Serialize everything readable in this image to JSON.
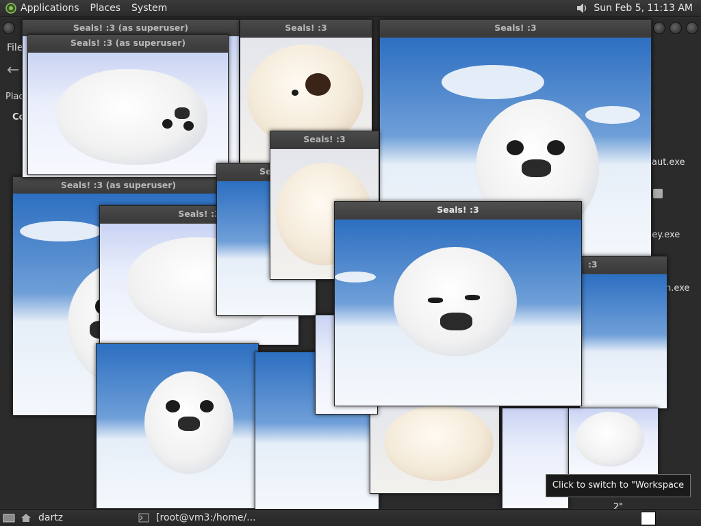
{
  "panel": {
    "menus": [
      "Applications",
      "Places",
      "System"
    ],
    "clock": "Sun Feb  5, 11:13 AM"
  },
  "background_window": {
    "fragments": [
      "File",
      "Plac",
      "Co",
      "aut.exe",
      "gey.exe",
      "h.exe"
    ]
  },
  "windows": [
    {
      "title": "Seals! :3 (as superuser)"
    },
    {
      "title": "Seals! :3"
    },
    {
      "title": "Seals! :3"
    },
    {
      "title": "Seals! :3 (as superuser)"
    },
    {
      "title": "Seals! :3 (as superuser)"
    },
    {
      "title": "Seals! :3"
    },
    {
      "title": "Se"
    },
    {
      "title": "Seals! :3"
    },
    {
      "title": "Seals! :3"
    },
    {
      "title": ":3"
    }
  ],
  "tooltip": "Click to switch to \"Workspace 2\"",
  "taskbar": {
    "items": [
      "dartz",
      "[root@vm3:/home/..."
    ]
  },
  "icons": [
    "gnome-foot-icon",
    "speaker-icon",
    "show-desktop-icon",
    "home-folder-icon",
    "terminal-icon",
    "workspace-pager-icon"
  ]
}
